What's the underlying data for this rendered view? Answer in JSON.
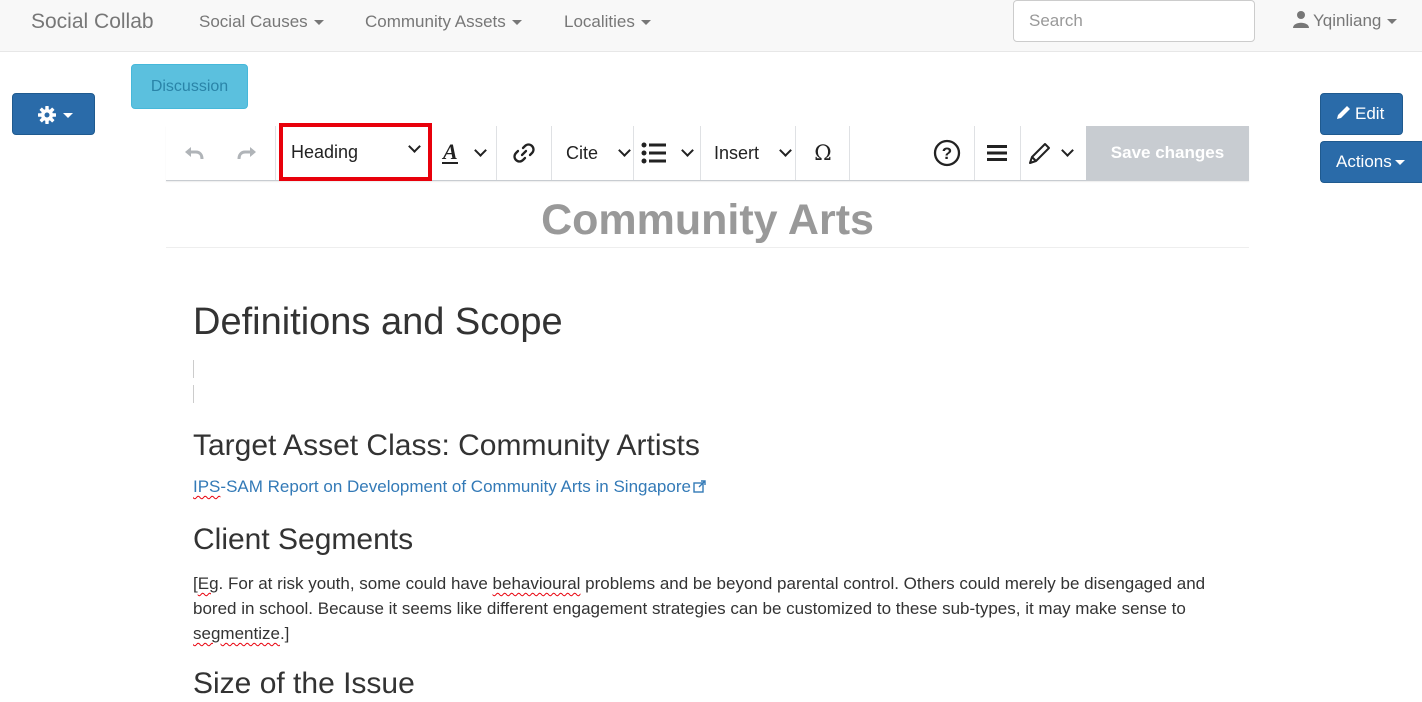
{
  "navbar": {
    "brand": "Social Collab",
    "menus": [
      {
        "label": "Social Causes"
      },
      {
        "label": "Community Assets"
      },
      {
        "label": "Localities"
      }
    ],
    "search_placeholder": "Search",
    "user_name": "Yqinliang"
  },
  "left_tools": {
    "gear_icon": "gear-icon"
  },
  "discussion_label": "Discussion",
  "right_buttons": {
    "edit_label": "Edit",
    "actions_label": "Actions"
  },
  "editor_toolbar": {
    "undo_icon": "undo-icon",
    "redo_icon": "redo-icon",
    "paragraph_format": "Heading",
    "text_style_icon": "text-style-icon",
    "link_icon": "link-icon",
    "cite_label": "Cite",
    "list_icon": "bullet-list-icon",
    "insert_label": "Insert",
    "special_char": "Ω",
    "help_icon": "help-icon",
    "menu_icon": "hamburger-icon",
    "edit_mode_icon": "pencil-icon",
    "save_label": "Save changes",
    "highlight_color": "#e8000b"
  },
  "page": {
    "title": "Community Arts",
    "sections": {
      "definitions": "Definitions and Scope",
      "target": "Target Asset Class: Community Artists",
      "link_prefix": "IPS",
      "link_rest": "-SAM Report on Development of Community Arts in Singapore",
      "segments": "Client Segments",
      "para_p1": "[",
      "para_eg": "Eg",
      "para_p2": ". For at risk youth, some could have ",
      "para_behavioural": "behavioural",
      "para_p3": " problems and be beyond parental control. Others could merely be disengaged and bored in school. Because it seems like different engagement strategies can be customized to these sub-types, it may make sense to ",
      "para_segmentize": "segmentize",
      "para_p4": ".]",
      "size": "Size of the Issue"
    }
  }
}
